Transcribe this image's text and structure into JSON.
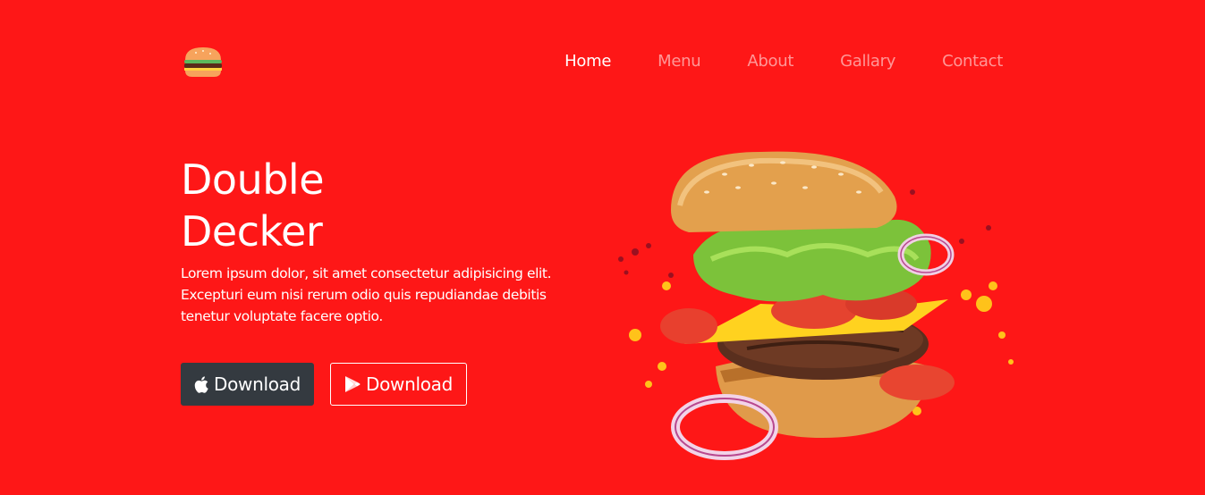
{
  "theme": {
    "background": "#fe1717",
    "dark_button": "#343a40",
    "text": "#ffffff"
  },
  "header": {
    "logo_icon": "burger-logo-icon",
    "nav": [
      {
        "label": "Home",
        "active": true
      },
      {
        "label": "Menu",
        "active": false
      },
      {
        "label": "About",
        "active": false
      },
      {
        "label": "Gallary",
        "active": false
      },
      {
        "label": "Contact",
        "active": false
      }
    ]
  },
  "hero": {
    "title_line1": "Double",
    "title_line2": "Decker",
    "description": "Lorem ipsum dolor, sit amet consectetur adipisicing elit. Excepturi eum nisi rerum odio quis repudiandae debitis tenetur voluptate facere optio.",
    "buttons": [
      {
        "label": "Download",
        "icon": "apple-icon"
      },
      {
        "label": "Download",
        "icon": "play-store-icon"
      }
    ],
    "image_icon": "burger-image"
  }
}
